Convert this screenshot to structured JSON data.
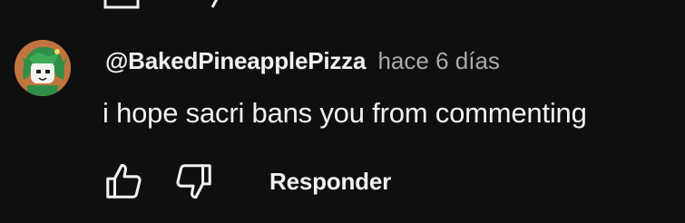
{
  "comment": {
    "author": "@BakedPineapplePizza",
    "timestamp": "hace 6 días",
    "text": "i hope sacri bans you from commenting",
    "avatar": "green-haired-character-avatar"
  },
  "actions": {
    "like_icon": "thumbs-up-icon",
    "dislike_icon": "thumbs-down-icon",
    "reply_label": "Responder"
  },
  "colors": {
    "background": "#0f0f0f",
    "primary_text": "#f1f1f1",
    "secondary_text": "#aaaaaa",
    "avatar_background": "#c2743f"
  }
}
